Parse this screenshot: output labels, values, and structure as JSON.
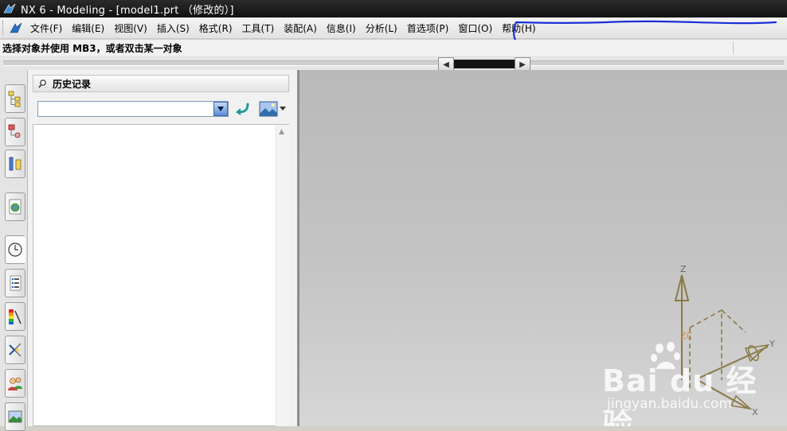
{
  "window": {
    "title": "NX 6 - Modeling - [model1.prt （修改的）]"
  },
  "menu": {
    "items": [
      {
        "label": "文件(F)"
      },
      {
        "label": "编辑(E)"
      },
      {
        "label": "视图(V)"
      },
      {
        "label": "插入(S)"
      },
      {
        "label": "格式(R)"
      },
      {
        "label": "工具(T)"
      },
      {
        "label": "装配(A)"
      },
      {
        "label": "信息(I)"
      },
      {
        "label": "分析(L)"
      },
      {
        "label": "首选项(P)"
      },
      {
        "label": "窗口(O)"
      },
      {
        "label": "帮助(H)"
      }
    ]
  },
  "status": {
    "prompt": "选择对象并使用 MB3，或者双击某一对象"
  },
  "resource_bar": {
    "tabs": [
      "assembly-navigator",
      "part-navigator",
      "constraint-navigator",
      "web-browser",
      "history",
      "system-materials",
      "color-palette",
      "process-studio",
      "roles",
      "system-scenes"
    ],
    "active_tab": "history"
  },
  "history_panel": {
    "title": "历史记录",
    "combo_value": ""
  },
  "viewport": {
    "background": "#c2c2c2",
    "triad": {
      "z_label": "Z",
      "y_label": "Y",
      "x_label": "X",
      "zc_label": "ZC"
    }
  },
  "watermark": {
    "logo": "Bai du 经验",
    "url": "jingyan.baidu.com"
  },
  "colors": {
    "annotation": "#1a2fd6",
    "titlebar": "#1a1a1a",
    "triad": "#8a7a48",
    "zc_label": "#d98a3a"
  }
}
